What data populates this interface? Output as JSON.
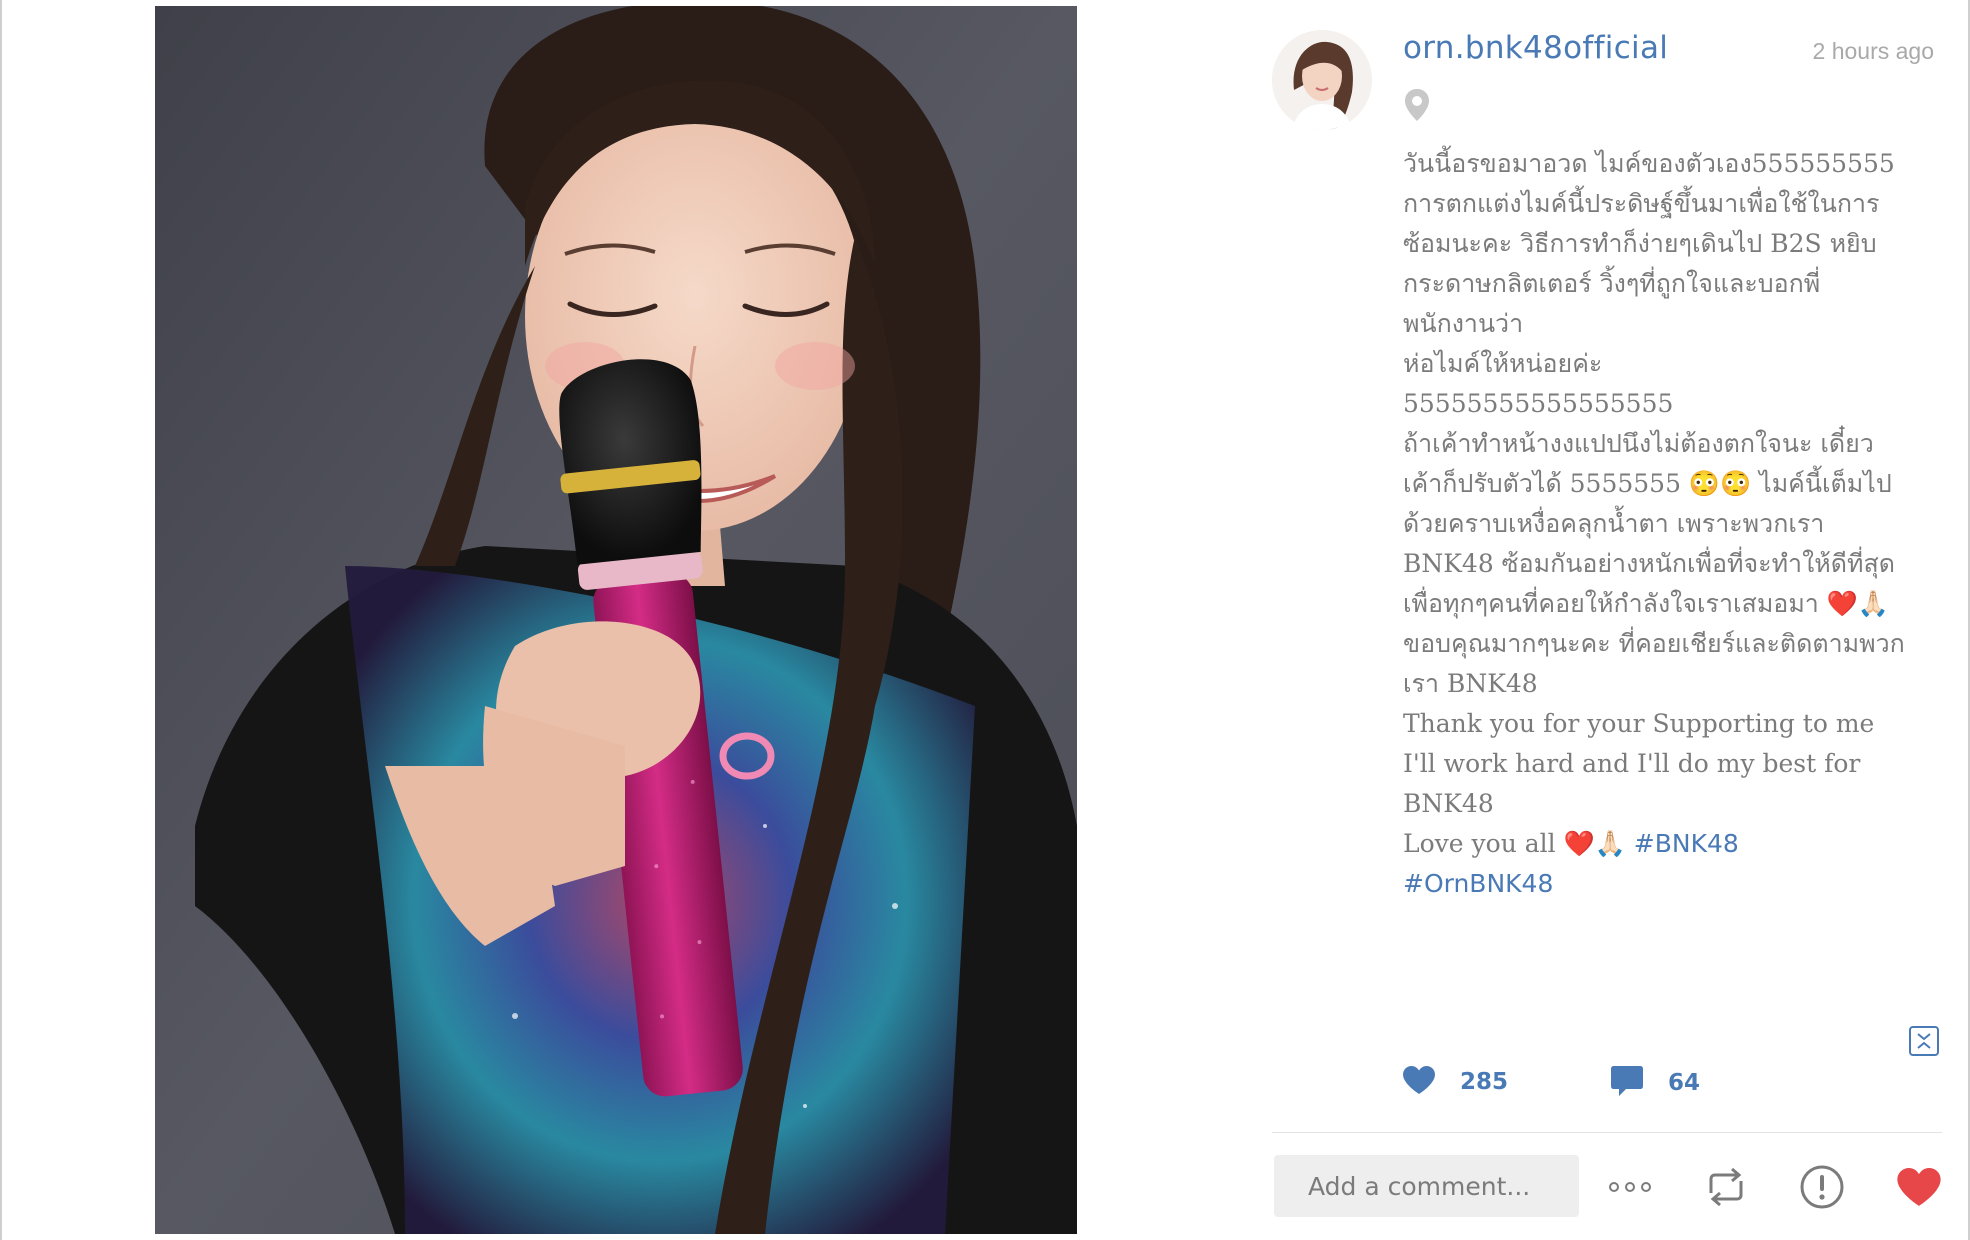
{
  "post": {
    "username": "orn.bnk48official",
    "timestamp": "2 hours ago",
    "caption_lines": [
      "วันนี้อรขอมาอวด ไมค์ของตัวเอง555555555",
      "การตกแต่งไมค์นี้ประดิษฐ์ขึ้นมาเพื่อใช้ในการ",
      "ซ้อมนะคะ วิธีการทำก็ง่ายๆเดินไป B2S หยิบ",
      "กระดาษกลิตเตอร์ วิ้งๆที่ถูกใจและบอกพี่",
      "พนักงานว่า",
      "ห่อไมค์ให้หน่อยค่ะ",
      "55555555555555555",
      "ถ้าเค้าทำหน้างงแปปนึงไม่ต้องตกใจนะ เดี๋ยว",
      "เค้าก็ปรับตัวได้ 5555555 😳😳 ไมค์นี้เต็มไป",
      "ด้วยคราบเหงื่อคลุกน้ำตา เพราะพวกเรา",
      "BNK48 ซ้อมกันอย่างหนักเพื่อที่จะทำให้ดีที่สุด",
      "เพื่อทุกๆคนที่คอยให้กำลังใจเราเสมอมา ❤️🙏🏻",
      "ขอบคุณมากๆนะคะ ที่คอยเชียร์และติดตามพวก",
      "เรา BNK48",
      "Thank you for your Supporting to me",
      "I'll work hard and I'll do my best for",
      "BNK48",
      "Love you all ❤️🙏🏻 "
    ],
    "hashtags": [
      "#BNK48",
      "#OrnBNK48"
    ],
    "likes": "285",
    "comments": "64",
    "comment_placeholder": "Add a comment..."
  },
  "icons": {
    "location": "location-pin-icon",
    "collapse": "collapse-icon",
    "like": "heart-icon",
    "comment": "comment-bubble-icon",
    "more": "more-dots-icon",
    "repost": "repost-icon",
    "report": "report-icon",
    "favorite": "heart-filled-icon"
  },
  "colors": {
    "accent": "#4a7ab5",
    "text": "#7b7b7b",
    "muted": "#a9a9a9",
    "heart": "#e8474a"
  }
}
